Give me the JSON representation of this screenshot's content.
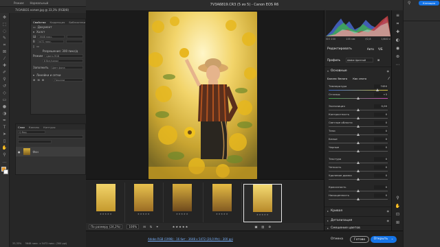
{
  "ps": {
    "topbar_items": [
      "Режим:",
      "Нормальный"
    ],
    "doc_tab": "7V3A6831 копия.jpg @ 33,3% (RGB/8)",
    "right_label": "Клеящая",
    "status_zoom": "33,33%",
    "status_doc": "3648 пикс. x 5472 пикс. (300 ppi)",
    "props": {
      "tabs": [
        "Свойства",
        "Коррекция",
        "Библиотеки"
      ],
      "doc_label": "Документ",
      "canvas_label": "Холст",
      "w_label": "Ш",
      "w_value": "3648 пикс.",
      "h_label": "В",
      "h_value": "5472 пикс.",
      "res_label": "Разрешение: 300 пикс/д",
      "mode_label": "Режим",
      "mode_value": "Цвета RGB",
      "bits_value": "8 бит/канал",
      "fill_label": "Заполнить",
      "fill_value": "Цвет фона",
      "rulers_label": "Линейки и сетки",
      "units_value": "Пиксели"
    },
    "layers": {
      "tabs": [
        "Слои",
        "Каналы",
        "Контуры"
      ],
      "search_placeholder": "Q Вид",
      "layer_name": "Фон"
    }
  },
  "acr": {
    "title": "7V3A6819.CR3 (5 из 5)  -  Canon EOS R6",
    "filmstrip": {
      "thumbs": [
        {
          "stars": "★★★★★"
        },
        {
          "stars": "★★★★★"
        },
        {
          "stars": "★★★★★"
        },
        {
          "stars": "★★★★★"
        },
        {
          "stars": "★★★★★"
        }
      ],
      "selected_index": 4
    },
    "bottombar": {
      "fit_label": "По размеру (24,2%)",
      "zoom_label": "100%",
      "rating": "★★★★★"
    },
    "file_info": "Adobe RGB (1998) - 16 бит - 3648 x 5472 (20,0 Мп) - 300 ppi",
    "buttons": {
      "cancel": "Отмена",
      "done": "Готово",
      "open": "Открыть"
    },
    "histogram_info": {
      "iso": "ISO 200",
      "lens": "135 мм",
      "aperture": "f/2,8",
      "shutter": "1/640 с"
    },
    "edit": {
      "title": "Редактировать",
      "auto": "Авто",
      "bw": "Ч/Б",
      "profile_label": "Профиль",
      "profile_value": "Adobe Цветной",
      "basic_section": "Основные",
      "wb_label": "Баланс белого",
      "wb_value": "Как снято",
      "sliders": [
        {
          "label": "Температура",
          "value": "7450",
          "pos": 0.82
        },
        {
          "label": "Оттенок",
          "value": "+3",
          "pos": 0.5
        },
        {
          "label": "Экспозиция",
          "value": "0,00",
          "pos": 0.5
        },
        {
          "label": "Контрастность",
          "value": "0",
          "pos": 0.5
        },
        {
          "label": "Светлые области",
          "value": "0",
          "pos": 0.5
        },
        {
          "label": "Тени",
          "value": "0",
          "pos": 0.5
        },
        {
          "label": "Белые",
          "value": "0",
          "pos": 0.5
        },
        {
          "label": "Черные",
          "value": "0",
          "pos": 0.5
        },
        {
          "label": "Текстура",
          "value": "0",
          "pos": 0.5
        },
        {
          "label": "Четкость",
          "value": "0",
          "pos": 0.5
        },
        {
          "label": "Удаление дымки",
          "value": "0",
          "pos": 0.5
        },
        {
          "label": "Красочность",
          "value": "0",
          "pos": 0.5
        },
        {
          "label": "Насыщенность",
          "value": "0",
          "pos": 0.5
        }
      ],
      "sections": [
        "Кривая",
        "Детализация",
        "Смешение цветов"
      ]
    }
  },
  "colors": {
    "accent": "#1473e6",
    "panel_bg": "#262626"
  }
}
